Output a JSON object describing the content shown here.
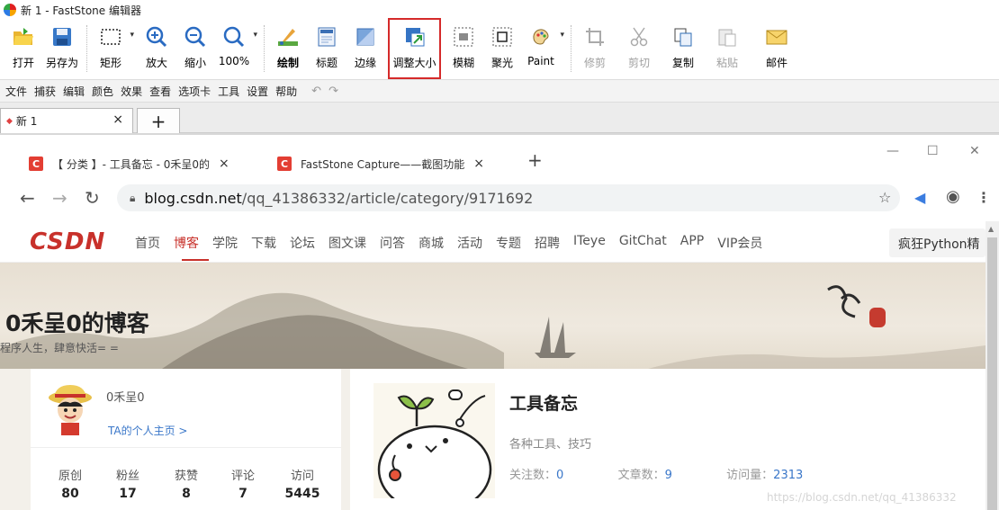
{
  "app": {
    "title": "新 1 - FastStone 编辑器"
  },
  "toolbar": {
    "open": "打开",
    "save_as": "另存为",
    "rect": "矩形",
    "zoom_in": "放大",
    "zoom_out": "缩小",
    "zoom_level": "100%",
    "draw": "绘制",
    "caption": "标题",
    "edge": "边缘",
    "resize": "调整大小",
    "blur": "模糊",
    "spotlight": "聚光",
    "paint": "Paint",
    "crop": "修剪",
    "cut": "剪切",
    "copy": "复制",
    "paste": "粘贴",
    "email": "邮件"
  },
  "menu": {
    "file": "文件",
    "capture": "捕获",
    "edit": "编辑",
    "color": "颜色",
    "effects": "效果",
    "view": "查看",
    "tabs": "选项卡",
    "tools": "工具",
    "settings": "设置",
    "help": "帮助"
  },
  "tabs": {
    "active_tab": "新 1"
  },
  "browser": {
    "tab1": "【 分类 】- 工具备忘 - 0禾呈0的",
    "tab2": "FastStone Capture——截图功能",
    "url_host": "blog.csdn.net",
    "url_path": "/qq_41386332/article/category/9171692"
  },
  "csdn": {
    "logo": "CSDN",
    "nav": [
      "首页",
      "博客",
      "学院",
      "下载",
      "论坛",
      "图文课",
      "问答",
      "商城",
      "活动",
      "专题",
      "招聘",
      "ITeye",
      "GitChat",
      "APP",
      "VIP会员"
    ],
    "search_text": "疯狂Python精",
    "blog_title": "0禾呈0的博客",
    "blog_subtitle": "程序人生，肆意快活= =",
    "profile_name": "0禾呈0",
    "profile_link": "TA的个人主页 >",
    "stats": {
      "original": {
        "label": "原创",
        "value": "80"
      },
      "fans": {
        "label": "粉丝",
        "value": "17"
      },
      "likes": {
        "label": "获赞",
        "value": "8"
      },
      "comments": {
        "label": "评论",
        "value": "7"
      },
      "visits": {
        "label": "访问",
        "value": "5445"
      }
    },
    "category": {
      "title": "工具备忘",
      "desc": "各种工具、技巧",
      "follow_label": "关注数：",
      "follow_value": "0",
      "articles_label": "文章数：",
      "articles_value": "9",
      "views_label": "访问量：",
      "views_value": "2313"
    },
    "watermark": "https://blog.csdn.net/qq_41386332"
  },
  "colors": {
    "highlight": "#d52a2a",
    "csdn_red": "#c8312b",
    "link_blue": "#3a77c9"
  }
}
